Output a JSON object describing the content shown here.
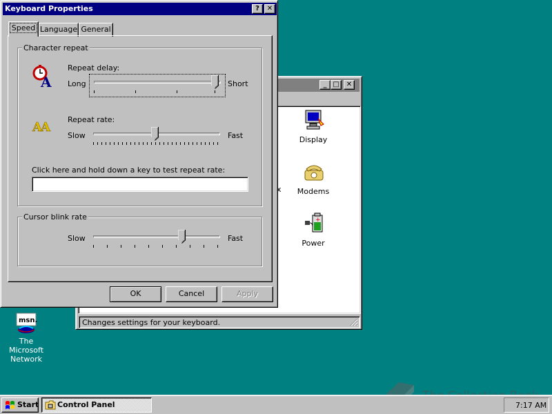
{
  "desktop": {
    "msn_label": "The Microsoft Network",
    "msn_icon_text": "msn."
  },
  "control_panel": {
    "title_buttons": {
      "minimize": "_",
      "maximize": "□",
      "close": "✕"
    },
    "icons": [
      {
        "label": "Display",
        "icon": "display-monitor-icon"
      },
      {
        "label": "Modems",
        "icon": "telephone-icon"
      },
      {
        "label": "Power",
        "icon": "power-plug-icon"
      }
    ],
    "partial_label": "x",
    "status_text": "Changes settings for your keyboard."
  },
  "dialog": {
    "title": "Keyboard Properties",
    "help_button": "?",
    "close_button": "✕",
    "tabs": [
      "Speed",
      "Language",
      "General"
    ],
    "active_tab": "Speed",
    "character_repeat": {
      "group_title": "Character repeat",
      "repeat_delay_label": "Repeat delay:",
      "delay_left": "Long",
      "delay_right": "Short",
      "delay_value": 1.0,
      "repeat_rate_label": "Repeat rate:",
      "rate_left": "Slow",
      "rate_right": "Fast",
      "rate_value": 0.5,
      "test_label": "Click here and hold down a key to test repeat rate:",
      "test_value": ""
    },
    "cursor_blink": {
      "group_title": "Cursor blink rate",
      "left": "Slow",
      "right": "Fast",
      "value": 0.7
    },
    "buttons": {
      "ok": "OK",
      "cancel": "Cancel",
      "apply": "Apply"
    }
  },
  "taskbar": {
    "start_label": "Start",
    "task_label": "Control Panel",
    "clock": "7:17 AM"
  },
  "watermark": {
    "text": "The Collection Book"
  },
  "colors": {
    "desktop": "#008080",
    "title_active": "#000080",
    "title_inactive": "#808080",
    "face": "#c0c0c0"
  }
}
